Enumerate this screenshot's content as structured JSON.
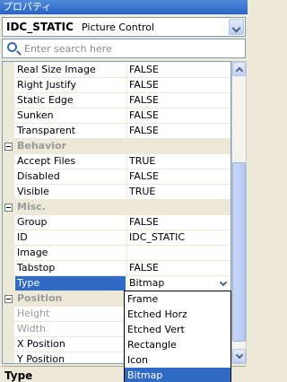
{
  "window": {
    "title": "プロパティ"
  },
  "object_selector": {
    "name": "IDC_STATIC",
    "type": "Picture Control"
  },
  "search": {
    "placeholder": "Enter search here"
  },
  "rows": [
    {
      "kind": "prop",
      "name": "Real Size Image",
      "value": "FALSE"
    },
    {
      "kind": "prop",
      "name": "Right Justify",
      "value": "FALSE"
    },
    {
      "kind": "prop",
      "name": "Static Edge",
      "value": "FALSE"
    },
    {
      "kind": "prop",
      "name": "Sunken",
      "value": "FALSE"
    },
    {
      "kind": "prop",
      "name": "Transparent",
      "value": "FALSE"
    },
    {
      "kind": "category",
      "name": "Behavior"
    },
    {
      "kind": "prop",
      "name": "Accept Files",
      "value": "TRUE"
    },
    {
      "kind": "prop",
      "name": "Disabled",
      "value": "FALSE"
    },
    {
      "kind": "prop",
      "name": "Visible",
      "value": "TRUE"
    },
    {
      "kind": "category",
      "name": "Misc."
    },
    {
      "kind": "prop",
      "name": "Group",
      "value": "FALSE"
    },
    {
      "kind": "prop",
      "name": "ID",
      "value": "IDC_STATIC"
    },
    {
      "kind": "prop",
      "name": "Image",
      "value": ""
    },
    {
      "kind": "prop",
      "name": "Tabstop",
      "value": "FALSE"
    },
    {
      "kind": "prop",
      "name": "Type",
      "value": "Bitmap",
      "selected": true
    },
    {
      "kind": "category",
      "name": "Position"
    },
    {
      "kind": "prop",
      "name": "Height",
      "value": "",
      "disabled": true
    },
    {
      "kind": "prop",
      "name": "Width",
      "value": "",
      "disabled": true
    },
    {
      "kind": "prop",
      "name": "X Position",
      "value": ""
    },
    {
      "kind": "prop",
      "name": "Y Position",
      "value": ""
    }
  ],
  "type_dropdown": {
    "options": [
      "Frame",
      "Etched Horz",
      "Etched Vert",
      "Rectangle",
      "Icon",
      "Bitmap"
    ],
    "selected": "Bitmap"
  },
  "description": {
    "title": "Type"
  },
  "colors": {
    "selection": "#316ac5",
    "title_bar": "#2b63c5",
    "border": "#7f9db9"
  }
}
